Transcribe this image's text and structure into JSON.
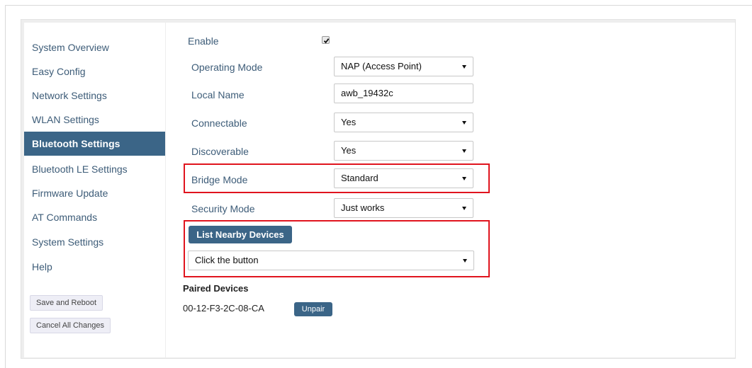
{
  "sidebar": {
    "items": [
      {
        "label": "System Overview"
      },
      {
        "label": "Easy Config"
      },
      {
        "label": "Network Settings"
      },
      {
        "label": "WLAN Settings"
      },
      {
        "label": "Bluetooth Settings"
      },
      {
        "label": "Bluetooth LE Settings"
      },
      {
        "label": "Firmware Update"
      },
      {
        "label": "AT Commands"
      },
      {
        "label": "System Settings"
      },
      {
        "label": "Help"
      }
    ],
    "active": "Bluetooth Settings",
    "save_reboot_label": "Save and Reboot",
    "cancel_changes_label": "Cancel All Changes"
  },
  "form": {
    "enable": {
      "label": "Enable",
      "checked": true
    },
    "operating_mode": {
      "label": "Operating Mode",
      "value": "NAP (Access Point)"
    },
    "local_name": {
      "label": "Local Name",
      "value": "awb_19432c"
    },
    "connectable": {
      "label": "Connectable",
      "value": "Yes"
    },
    "discoverable": {
      "label": "Discoverable",
      "value": "Yes"
    },
    "bridge_mode": {
      "label": "Bridge Mode",
      "value": "Standard"
    },
    "security_mode": {
      "label": "Security Mode",
      "value": "Just works"
    },
    "list_nearby_label": "List Nearby Devices",
    "nearby_devices_select": {
      "value": "Click the button"
    },
    "paired_devices": {
      "heading": "Paired Devices",
      "items": [
        {
          "address": "00-12-F3-2C-08-CA",
          "unpair_label": "Unpair"
        }
      ]
    }
  },
  "colors": {
    "accent": "#3b6587",
    "highlight_border": "#e0141e",
    "link_text": "#3d5c78"
  }
}
